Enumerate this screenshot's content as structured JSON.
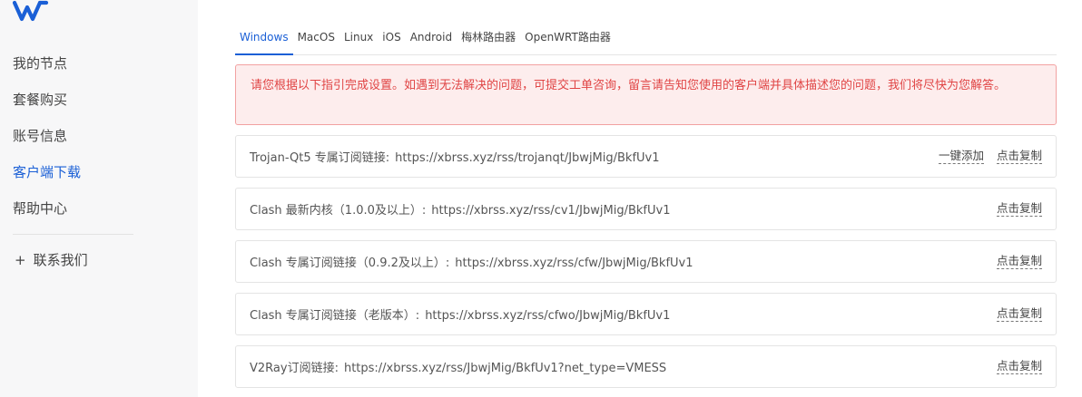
{
  "sidebar": {
    "logo": "W",
    "items": [
      {
        "label": "我的节点"
      },
      {
        "label": "套餐购买"
      },
      {
        "label": "账号信息"
      },
      {
        "label": "客户端下载"
      },
      {
        "label": "帮助中心"
      }
    ],
    "contact": {
      "plus": "+",
      "label": "联系我们"
    }
  },
  "tabs": [
    "Windows",
    "MacOS",
    "Linux",
    "iOS",
    "Android",
    "梅林路由器",
    "OpenWRT路由器"
  ],
  "active_tab": "Windows",
  "alert": {
    "text": "请您根据以下指引完成设置。如遇到无法解决的问题，可提交工单咨询，留言请告知您使用的客户端并具体描述您的问题，我们将尽快为您解答。"
  },
  "links": [
    {
      "label": "Trojan-Qt5 专属订阅链接:",
      "url": "https://xbrss.xyz/rss/trojanqt/JbwjMig/BkfUv1",
      "add": "一键添加",
      "copy": "点击复制"
    },
    {
      "label": "Clash 最新内核（1.0.0及以上）:",
      "url": "https://xbrss.xyz/rss/cv1/JbwjMig/BkfUv1",
      "copy": "点击复制"
    },
    {
      "label": "Clash 专属订阅链接（0.9.2及以上）:",
      "url": "https://xbrss.xyz/rss/cfw/JbwjMig/BkfUv1",
      "copy": "点击复制"
    },
    {
      "label": "Clash 专属订阅链接（老版本）:",
      "url": "https://xbrss.xyz/rss/cfwo/JbwjMig/BkfUv1",
      "copy": "点击复制"
    },
    {
      "label": "V2Ray订阅链接:",
      "url": "https://xbrss.xyz/rss/JbwjMig/BkfUv1?net_type=VMESS",
      "copy": "点击复制"
    }
  ],
  "colors": {
    "accent": "#1a5fd6",
    "alert_text": "#e04444",
    "alert_bg": "#fdeded",
    "alert_border": "#f2a1a1",
    "sidebar_bg": "#f7f7f8"
  }
}
